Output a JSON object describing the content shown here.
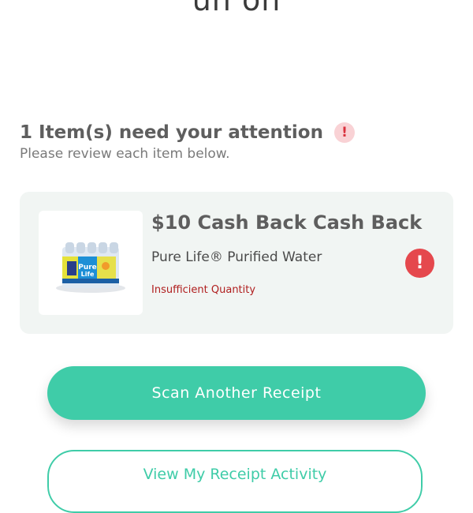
{
  "header": {
    "partial_title": "uh oh"
  },
  "attention": {
    "title": "1 Item(s) need your attention",
    "subtitle": "Please review each item below.",
    "alert_glyph": "!"
  },
  "item": {
    "offer_title": "$10 Cash Back Cash Back",
    "product_name": "Pure Life® Purified Water",
    "status": "Insufficient Quantity",
    "alert_glyph": "!",
    "image_icon": "water-bottle-pack-image"
  },
  "buttons": {
    "scan_label": "Scan Another Receipt",
    "view_activity_label": "View My Receipt Activity"
  },
  "colors": {
    "accent": "#3fcca8",
    "alert": "#e5484d",
    "error_text": "#b01e1e"
  }
}
